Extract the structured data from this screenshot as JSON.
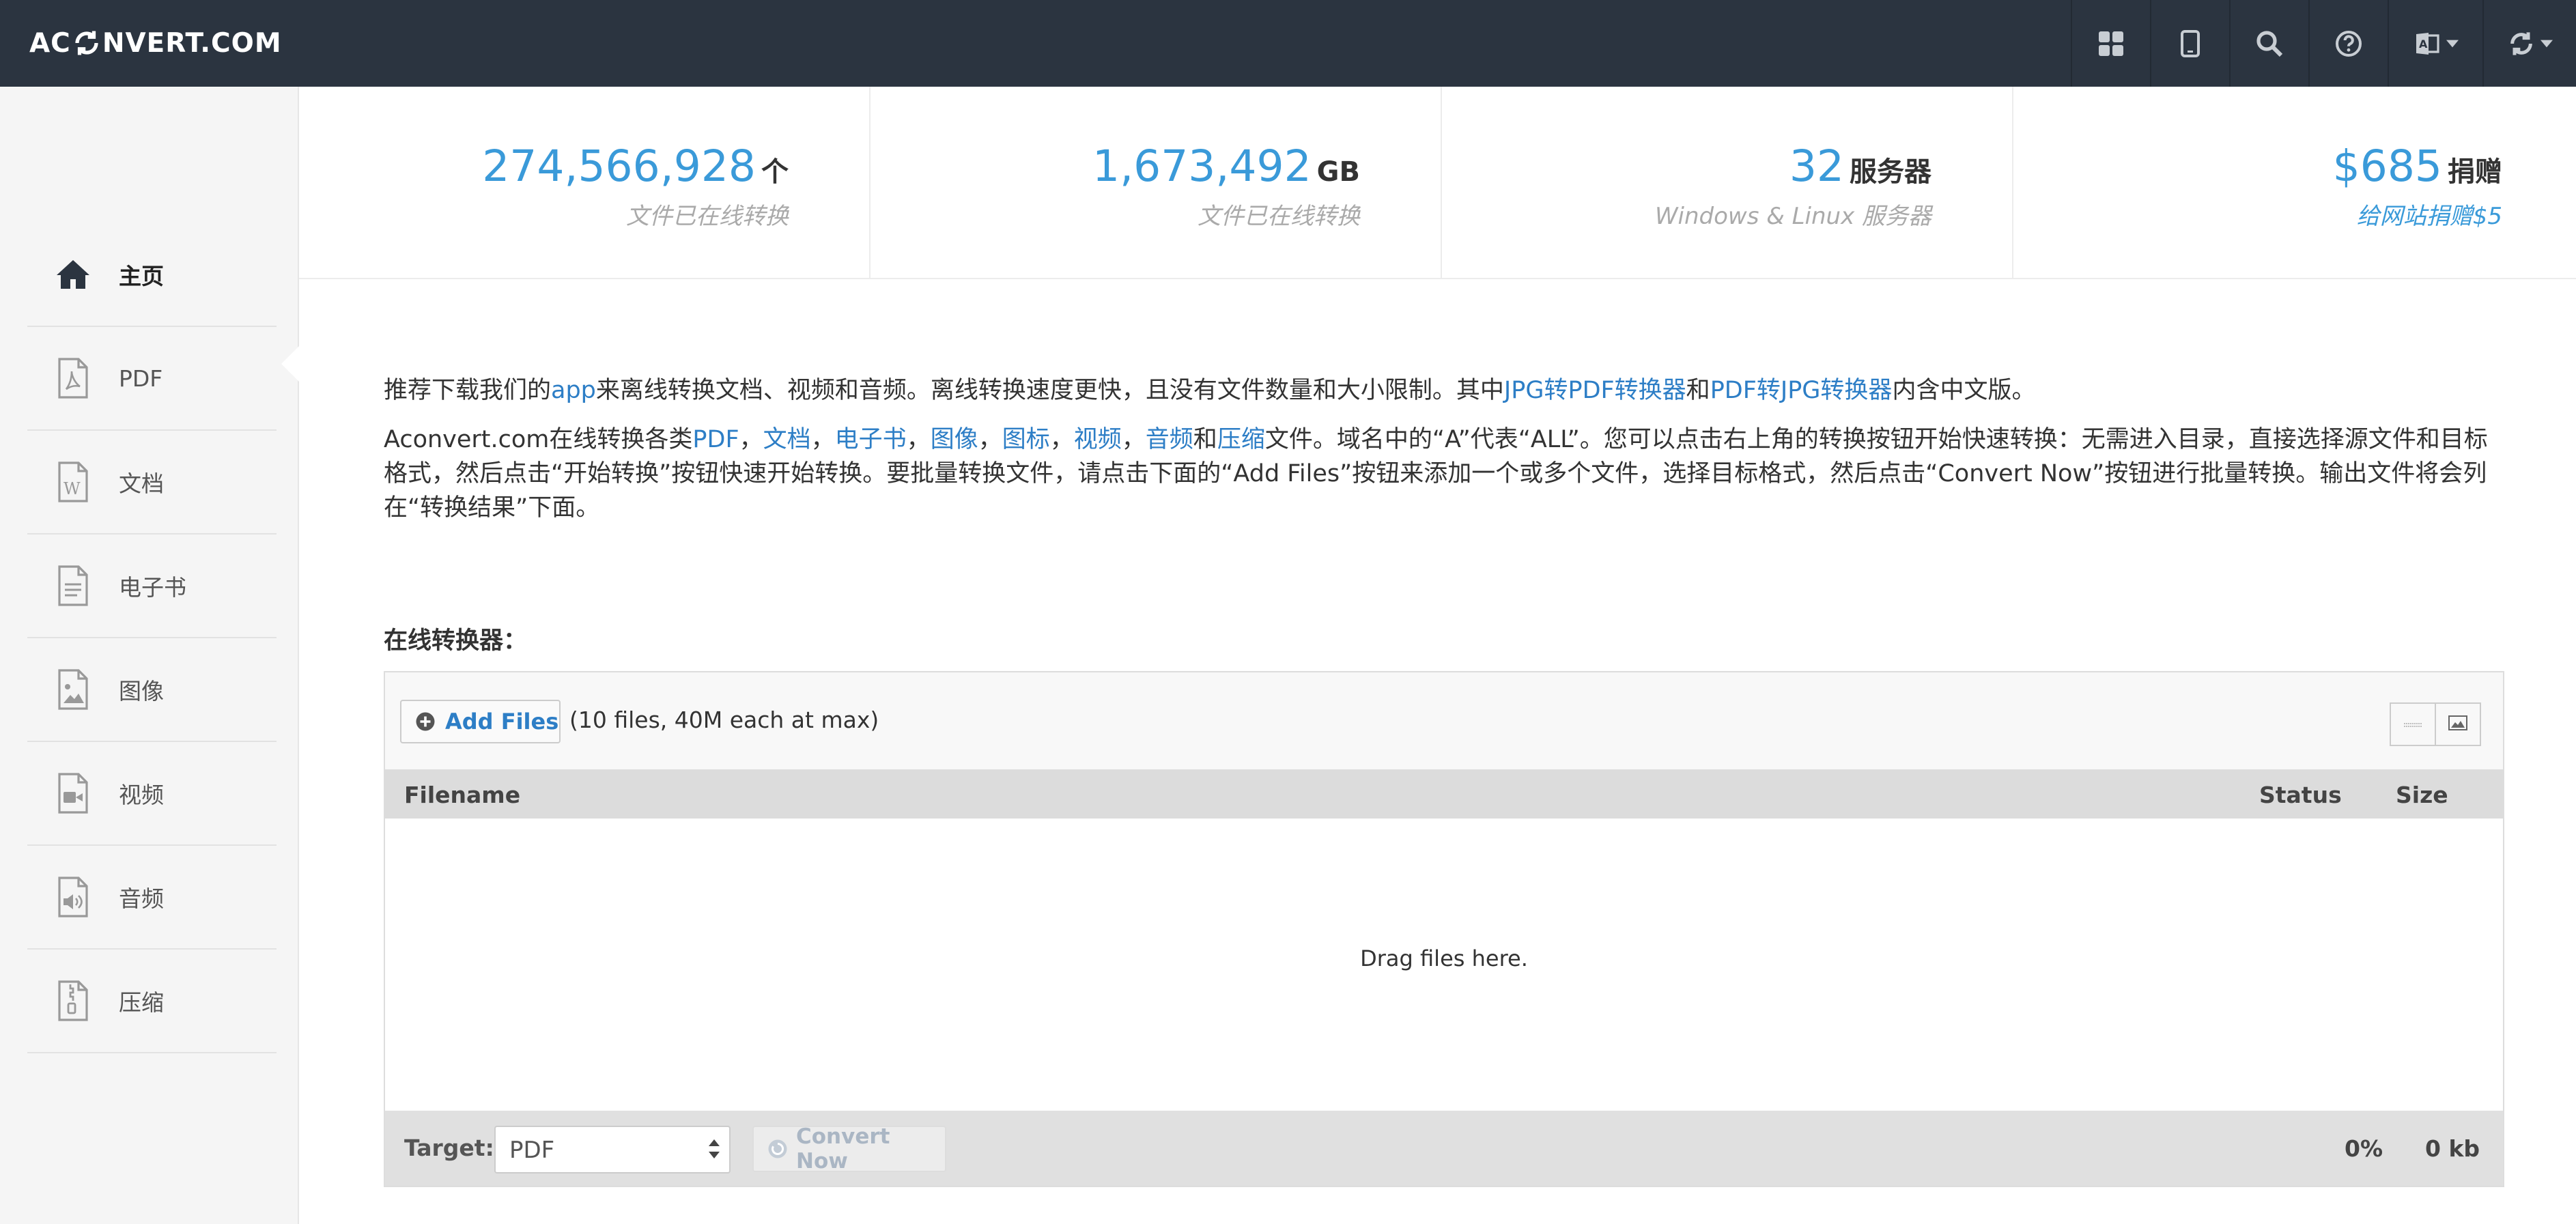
{
  "brand": {
    "logo_left": "AC",
    "logo_right": "NVERT.COM"
  },
  "topnav": [
    "grid-icon",
    "tablet-icon",
    "search-icon",
    "help-icon",
    "language-icon",
    "convert-menu-icon"
  ],
  "sidebar": {
    "items": [
      {
        "label": "主页",
        "icon": "home-icon",
        "active": true
      },
      {
        "label": "PDF",
        "icon": "pdf-file-icon"
      },
      {
        "label": "文档",
        "icon": "word-file-icon"
      },
      {
        "label": "电子书",
        "icon": "ebook-file-icon"
      },
      {
        "label": "图像",
        "icon": "image-file-icon"
      },
      {
        "label": "视频",
        "icon": "video-file-icon"
      },
      {
        "label": "音频",
        "icon": "audio-file-icon"
      },
      {
        "label": "压缩",
        "icon": "archive-file-icon"
      }
    ]
  },
  "stats": [
    {
      "value": "274,566,928",
      "unit": "个",
      "sub": "文件已在线转换"
    },
    {
      "value": "1,673,492",
      "unit": "GB",
      "sub": "文件已在线转换"
    },
    {
      "value": "32",
      "unit": "服务器",
      "sub": "Windows & Linux 服务器"
    },
    {
      "value": "$685",
      "unit": "捐赠",
      "sub": "给网站捐赠$5"
    }
  ],
  "intro": {
    "p1_a": "推荐下载我们的",
    "p1_link_app": "app",
    "p1_b": "来离线转换文档、视频和音频。离线转换速度更快，且没有文件数量和大小限制。其中",
    "p1_link_jpg2pdf": "JPG转PDF转换器",
    "p1_c": "和",
    "p1_link_pdf2jpg": "PDF转JPG转换器",
    "p1_d": "内含中文版。",
    "p2_a": "Aconvert.com在线转换各类",
    "p2_links": [
      "PDF",
      "文档",
      "电子书",
      "图像",
      "图标",
      "视频",
      "音频"
    ],
    "p2_sep": "，",
    "p2_and": "和",
    "p2_link_last": "压缩",
    "p2_b": "文件。域名中的“A”代表“ALL”。您可以点击右上角的转换按钮开始快速转换：无需进入目录，直接选择源文件和目标格式，然后点击“开始转换”按钮快速开始转换。要批量转换文件，请点击下面的“Add Files”按钮来添加一个或多个文件，选择目标格式，然后点击“Convert Now”按钮进行批量转换。输出文件将会列在“转换结果”下面。"
  },
  "converter": {
    "title": "在线转换器：",
    "add_files": "Add Files",
    "limit_note": "(10 files, 40M each at max)",
    "columns": {
      "filename": "Filename",
      "status": "Status",
      "size": "Size"
    },
    "drop_text": "Drag files here.",
    "target_label": "Target:",
    "target_value": "PDF",
    "convert_now": "Convert Now",
    "progress": "0%",
    "total_size": "0 kb"
  }
}
